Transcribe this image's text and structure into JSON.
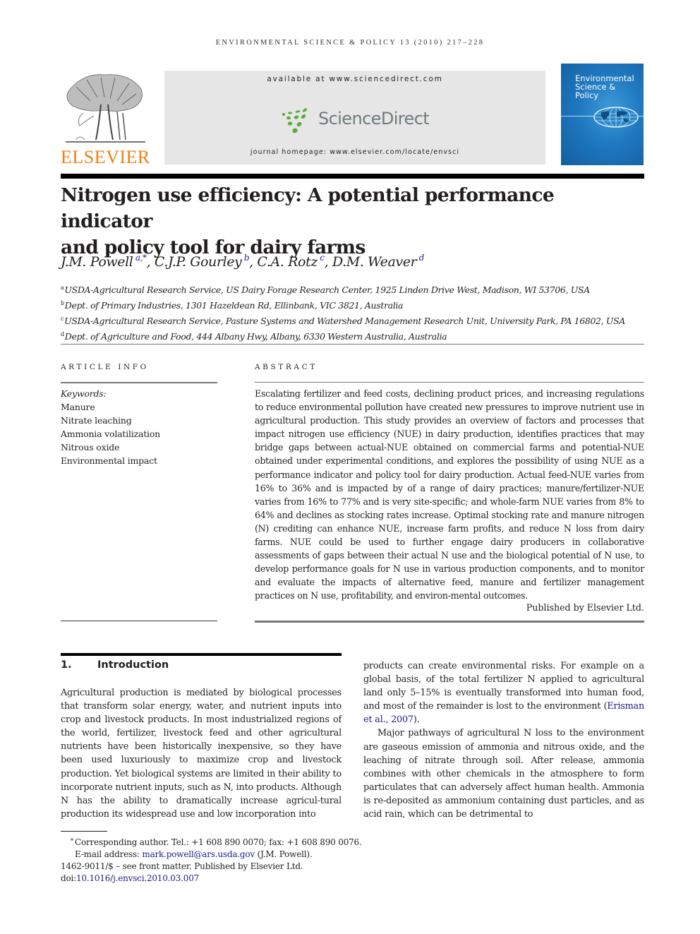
{
  "running_header": "Environmental Science & Policy 13 (2010) 217–228",
  "masthead": {
    "publisher_logo_text": "ELSEVIER",
    "available_at": "available at www.sciencedirect.com",
    "sciencedirect_logo_text": "ScienceDirect",
    "journal_homepage": "journal homepage: www.elsevier.com/locate/envsci",
    "cover_title": [
      "Environmental",
      "Science &",
      "Policy"
    ],
    "colors": {
      "elsevier_orange": "#f07f14",
      "sciencedirect_green": "#5aad3c",
      "sciencedirect_gray": "#6f7b7b",
      "cover_blue": "#1f78c0",
      "link_blue": "#1c1c8c"
    }
  },
  "article": {
    "title_line1": "Nitrogen use efficiency: A potential performance indicator",
    "title_line2": "and policy tool for dairy farms",
    "authors": [
      {
        "name": "J.M. Powell",
        "sup": "a,*",
        "sep": ", "
      },
      {
        "name": "C.J.P. Gourley",
        "sup": "b",
        "sep": ", "
      },
      {
        "name": "C.A. Rotz",
        "sup": "c",
        "sep": ", "
      },
      {
        "name": "D.M. Weaver",
        "sup": "d",
        "sep": ""
      }
    ],
    "affiliations": [
      {
        "key": "a",
        "text": "USDA-Agricultural Research Service, US Dairy Forage Research Center, 1925 Linden Drive West, Madison, WI 53706, USA"
      },
      {
        "key": "b",
        "text": "Dept. of Primary Industries, 1301 Hazeldean Rd, Ellinbank, VIC 3821, Australia"
      },
      {
        "key": "c",
        "text": "USDA-Agricultural Research Service, Pasture Systems and Watershed Management Research Unit, University Park, PA 16802, USA"
      },
      {
        "key": "d",
        "text": "Dept. of Agriculture and Food, 444 Albany Hwy, Albany, 6330 Western Australia, Australia"
      }
    ]
  },
  "article_info": {
    "label": "ARTICLE INFO",
    "keywords_heading": "Keywords:",
    "keywords": [
      "Manure",
      "Nitrate leaching",
      "Ammonia volatilization",
      "Nitrous oxide",
      "Environmental impact"
    ]
  },
  "abstract": {
    "label": "ABSTRACT",
    "text": "Escalating fertilizer and feed costs, declining product prices, and increasing regulations to reduce environmental pollution have created new pressures to improve nutrient use in agricultural production. This study provides an overview of factors and processes that impact nitrogen use efficiency (NUE) in dairy production, identifies practices that may bridge gaps between actual-NUE obtained on commercial farms and potential-NUE obtained under experimental conditions, and explores the possibility of using NUE as a performance indicator and policy tool for dairy production. Actual feed-NUE varies from 16% to 36% and is impacted by of a range of dairy practices; manure/fertilizer-NUE varies from 16% to 77% and is very site-specific; and whole-farm NUE varies from 8% to 64% and declines as stocking rates increase. Optimal stocking rate and manure nitrogen (N) crediting can enhance NUE, increase farm profits, and reduce N loss from dairy farms. NUE could be used to further engage dairy producers in collaborative assessments of gaps between their actual N use and the biological potential of N use, to develop performance goals for N use in various production components, and to monitor and evaluate the impacts of alternative feed, manure and fertilizer management practices on N use, profitability, and environ-mental outcomes.",
    "published_by": "Published by Elsevier Ltd."
  },
  "introduction": {
    "number": "1.",
    "heading": "Introduction",
    "para1": "Agricultural production is mediated by biological processes that transform solar energy, water, and nutrient inputs into crop and livestock products. In most industrialized regions of the world, fertilizer, livestock feed and other agricultural nutrients have been historically inexpensive, so they have been used luxuriously to maximize crop and livestock production. Yet biological systems are limited in their ability to incorporate nutrient inputs, such as N, into products. Although N has the ability to dramatically increase agricul-tural production its widespread use and low incorporation into",
    "para1_cont_before": "products can create environmental risks. For example on a global basis, of the total fertilizer N applied to agricultural land only 5–15% is eventually transformed into human food, and most of the remainder is lost to the environment (",
    "para1_citation": "Erisman et al., 2007",
    "para1_cont_after": ").",
    "para2": "Major pathways of agricultural N loss to the environment are gaseous emission of ammonia and nitrous oxide, and the leaching of nitrate through soil. After release, ammonia combines with other chemicals in the atmosphere to form particulates that can adversely affect human health. Ammonia is re-deposited as ammonium containing dust particles, and as acid rain, which can be detrimental to"
  },
  "footnotes": {
    "star": "*",
    "corresponding": "Corresponding author. Tel.: +1 608 890 0070; fax: +1 608 890 0076.",
    "email_label": "E-mail address: ",
    "email": "mark.powell@ars.usda.gov",
    "email_after": " (J.M. Powell).",
    "issn_line": "1462-9011/$ – see front matter. Published by Elsevier Ltd.",
    "doi_label": "doi:",
    "doi": "10.1016/j.envsci.2010.03.007"
  }
}
